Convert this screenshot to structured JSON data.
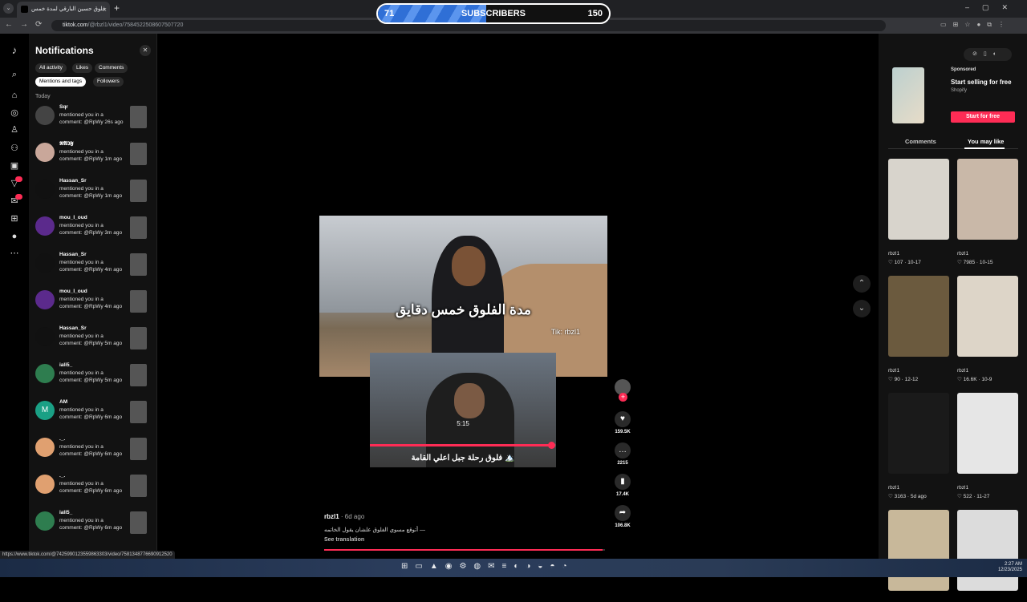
{
  "browser": {
    "tab_title": "فلوق حسين البارقي لمدة خمس",
    "url_host": "tiktok.com",
    "url_path": "/@rbzl1/video/7584522508607507720",
    "status_url": "https://www.tiktok.com/@7425990123559863303/video/7581348776690912520"
  },
  "overlay": {
    "current": "71",
    "label": "SUBSCRIBERS",
    "goal": "150",
    "fill_fraction": 0.47
  },
  "notifications": {
    "title": "Notifications",
    "filters": [
      "All activity",
      "Likes",
      "Comments",
      "Mentions and tags",
      "Followers"
    ],
    "section": "Today",
    "items": [
      {
        "name": "Sqr",
        "text": "mentioned you in a comment: @RpWy",
        "time": "26s ago",
        "avatar_color": "#444"
      },
      {
        "name": "𝕹𝕬𝕴𝕱",
        "text": "mentioned you in a comment: @RpWy",
        "time": "1m ago",
        "avatar_color": "#c9a79a"
      },
      {
        "name": "Hassan_Sr",
        "text": "mentioned you in a comment: @RpWy",
        "time": "1m ago",
        "avatar_color": "#111"
      },
      {
        "name": "mou_l_oud",
        "text": "mentioned you in a comment: @RpWy",
        "time": "3m ago",
        "avatar_color": "#5b2a8c"
      },
      {
        "name": "Hassan_Sr",
        "text": "mentioned you in a comment: @RpWy",
        "time": "4m ago",
        "avatar_color": "#111"
      },
      {
        "name": "mou_l_oud",
        "text": "mentioned you in a comment: @RpWy",
        "time": "4m ago",
        "avatar_color": "#5b2a8c"
      },
      {
        "name": "Hassan_Sr",
        "text": "mentioned you in a comment: @RpWy",
        "time": "5m ago",
        "avatar_color": "#111"
      },
      {
        "name": "iali5_",
        "text": "mentioned you in a comment: @RpWy",
        "time": "5m ago",
        "avatar_color": "#2e7d4f"
      },
      {
        "name": "AM",
        "text": "mentioned you in a comment: @RpWy",
        "time": "6m ago",
        "avatar_color": "#1aa085",
        "initial": "M"
      },
      {
        "name": "._.",
        "text": "mentioned you in a comment: @RpWy",
        "time": "6m ago",
        "avatar_color": "#e0a070"
      },
      {
        "name": "._.",
        "text": "mentioned you in a comment: @RpWy",
        "time": "6m ago",
        "avatar_color": "#e0a070"
      },
      {
        "name": "iali5_",
        "text": "mentioned you in a comment: @RpWy",
        "time": "6m ago",
        "avatar_color": "#2e7d4f"
      }
    ]
  },
  "video": {
    "caption": "مدة الفلوق خمس دقايق",
    "watermark": "Tik: rbzl1",
    "inset_time": "5:15",
    "inset_title": "فلوق رحلة جبل اعلي القامة 🏔️",
    "inset_progress": 0.98,
    "main_progress": 0.99
  },
  "actions": {
    "likes": "159.5K",
    "comments": "2215",
    "saves": "17.4K",
    "shares": "106.8K"
  },
  "post": {
    "author": "rbzl1",
    "date": "· 6d ago",
    "description": "أتوقع مسوي الفلوق علشان يقول الخاتمه —",
    "see_translation": "See translation"
  },
  "ad": {
    "sponsored": "Sponsored",
    "title": "Start selling for free",
    "brand": "Shopify",
    "cta": "Start for free"
  },
  "right_tabs": {
    "comments": "Comments",
    "you_may_like": "You may like"
  },
  "cards": [
    {
      "author": "rbzl1",
      "stats": "♡ 107 · 10-17",
      "color": "#d8d4cc"
    },
    {
      "author": "rbzl1",
      "stats": "♡ 7985 · 10-15",
      "color": "#c9b8a8"
    },
    {
      "author": "rbzl1",
      "stats": "♡ 90 · 12-12",
      "color": "#6b5a3e"
    },
    {
      "author": "rbzl1",
      "stats": "♡ 16.6K · 10-9",
      "color": "#ddd5c8"
    },
    {
      "author": "rbzl1",
      "stats": "♡ 3163 · 5d ago",
      "color": "#1a1a1a"
    },
    {
      "author": "rbzl1",
      "stats": "♡ 522 · 11-27",
      "color": "#e6e6e6"
    },
    {
      "author": "",
      "stats": "",
      "color": "#c8b89a"
    },
    {
      "author": "",
      "stats": "",
      "color": "#dcdcdc"
    }
  ],
  "taskbar": {
    "time": "2:27 AM",
    "date": "12/23/2025"
  }
}
